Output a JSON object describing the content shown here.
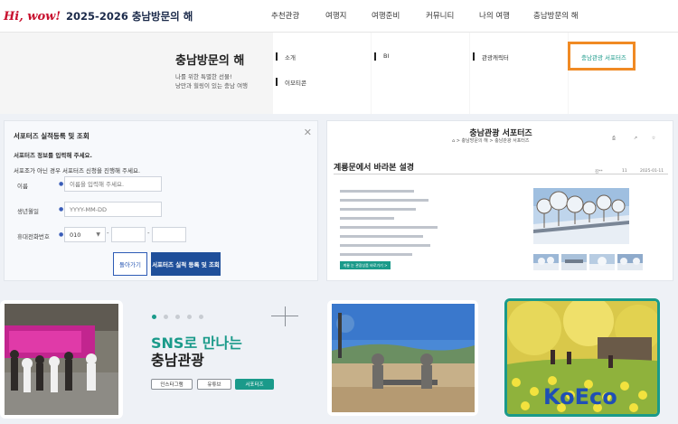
{
  "header": {
    "logo_mark": "Hi, wow!",
    "logo_text": "2025-2026 충남방문의 해",
    "nav": [
      "추천관광",
      "여행지",
      "여행준비",
      "커뮤니티",
      "나의 여행",
      "충남방문의 해"
    ]
  },
  "mega_menu": {
    "title": "충남방문의 해",
    "subtitle_lines": [
      "나를 위한 특별한 선물!",
      "낭만과 힐링이 있는 충남 여행"
    ],
    "items": [
      "소개",
      "이모티콘",
      "BI",
      "관광캐릭터",
      "충남관광 서포터즈"
    ]
  },
  "form": {
    "title": "서포터즈 실적등록 및 조회",
    "intro_line1": "서포터즈 정보를 입력해 주세요.",
    "intro_line2": "서포조가 아닌 경우 서포터즈 신청을 진행해 주세요.",
    "name_label": "이름",
    "name_placeholder": "이름을 입력해 주세요.",
    "birth_label": "생년월일",
    "birth_placeholder": "YYYY-MM-DD",
    "phone_label": "휴대전화번호",
    "phone_prefix": "010",
    "back_button": "돌아가기",
    "submit_button": "서포터즈 실적 등록 및 조회"
  },
  "article": {
    "page_title": "충남관광 서포터즈",
    "breadcrumb": "⌂  >  충남방문의 해  >  충남관광 서포터즈",
    "headline": "계룡문에서 바라본 설경",
    "meta_author": "김**",
    "meta_views": "11",
    "meta_date": "2025-01-11",
    "more_button": "계룡 눈 관광상품 바로가기 >",
    "icons": [
      "print-icon",
      "share-icon",
      "bookmark-icon"
    ]
  },
  "sns": {
    "line1": "SNS로 만나는",
    "line2": "충남관광",
    "chips": [
      "인스타그램",
      "유튜브",
      "서포터즈"
    ],
    "active_chip": "서포터즈"
  },
  "colors": {
    "teal": "#1a9a8a",
    "navy": "#1f4f9a",
    "highlight_border": "#f08a24",
    "background_band": "#eef1f6"
  },
  "watermark": {
    "text": "KoEco"
  }
}
